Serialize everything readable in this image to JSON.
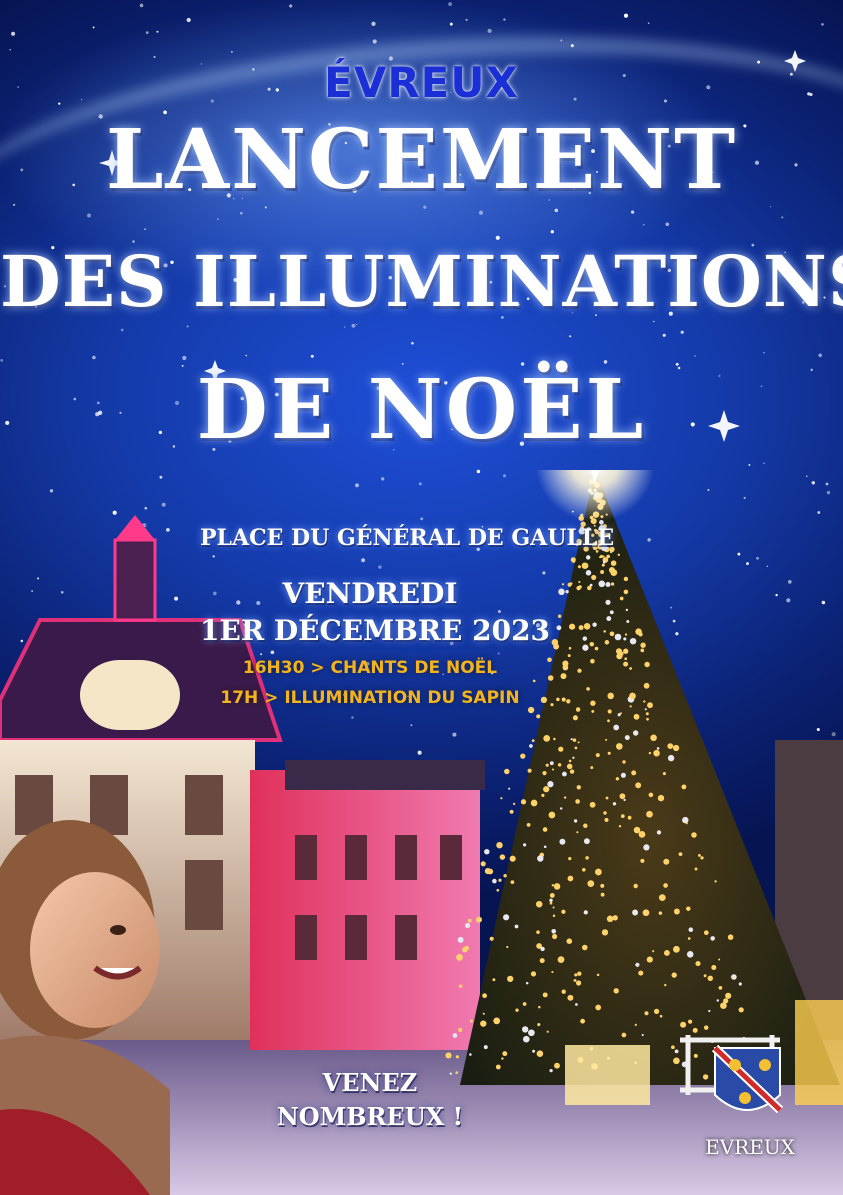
{
  "poster": {
    "city_title": "ÉVREUX",
    "title_line1": "LANCEMENT",
    "title_line2": "DES ILLUMINATIONS",
    "title_line3": "DE NOËL",
    "place": "PLACE DU GÉNÉRAL DE GAULLE",
    "day": "VENDREDI",
    "date": "1ER DÉCEMBRE 2023",
    "program": [
      "16H30 > CHANTS DE NOËL",
      "17H > ILLUMINATION DU SAPIN"
    ],
    "call_line1": "VENEZ",
    "call_line2": "NOMBREUX !",
    "logo_city": "EVREUX"
  },
  "colors": {
    "sky": "#143aa8",
    "city_title": "#1a2fd6",
    "program_text": "#f2b320",
    "tree_lights": "#ffd36a",
    "building_red": "#e0305a",
    "building_pink": "#f07ab0"
  },
  "icons": [
    "city-coat-of-arms-icon",
    "christmas-tree-icon",
    "star-icon"
  ]
}
